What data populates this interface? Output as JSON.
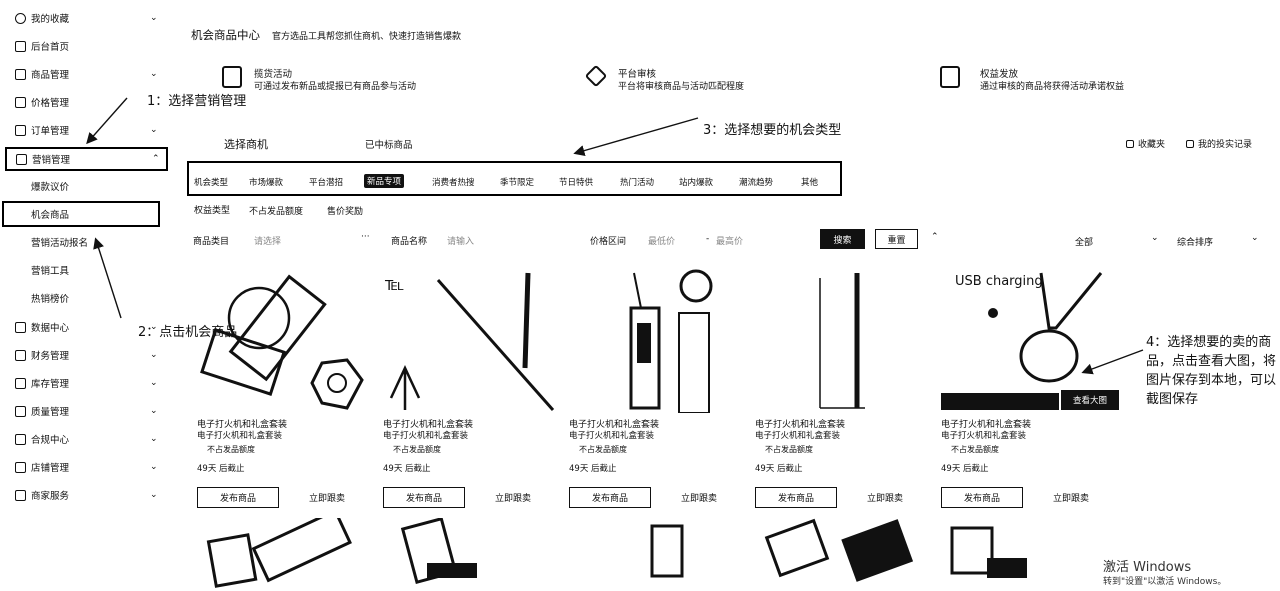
{
  "sidebar": {
    "items": [
      {
        "label": "我的收藏",
        "chev": "⌄"
      },
      {
        "label": "后台首页",
        "chev": ""
      },
      {
        "label": "商品管理",
        "chev": "⌄"
      },
      {
        "label": "价格管理",
        "chev": ""
      },
      {
        "label": "订单管理",
        "chev": "⌄"
      },
      {
        "label": "营销管理",
        "chev": "⌃"
      },
      {
        "label": "数据中心",
        "chev": "⌄"
      },
      {
        "label": "财务管理",
        "chev": "⌄"
      },
      {
        "label": "库存管理",
        "chev": "⌄"
      },
      {
        "label": "质量管理",
        "chev": "⌄"
      },
      {
        "label": "合规中心",
        "chev": "⌄"
      },
      {
        "label": "店铺管理",
        "chev": "⌄"
      },
      {
        "label": "商家服务",
        "chev": "⌄"
      }
    ],
    "sub_items": [
      "爆款议价",
      "机会商品",
      "营销活动报名",
      "营销工具",
      "热销榜价"
    ]
  },
  "header": {
    "title": "机会商品中心",
    "subtitle": "官方选品工具帮您抓住商机、快速打造销售爆款"
  },
  "features": [
    {
      "title": "揽货活动",
      "desc": "可通过发布新品或提报已有商品参与活动"
    },
    {
      "title": "平台审核",
      "desc": "平台将审核商品与活动匹配程度"
    },
    {
      "title": "权益发放",
      "desc": "通过审核的商品将获得活动承诺权益"
    }
  ],
  "tabs": {
    "tab1": "选择商机",
    "tab2": "已中标商品"
  },
  "top_links": {
    "collect": "收藏夹",
    "records": "我的投实记录"
  },
  "type_bar": {
    "label": "机会类型",
    "items": [
      "市场爆款",
      "平台潜招",
      "新品专项",
      "消费者热搜",
      "季节限定",
      "节日特供",
      "热门活动",
      "站内爆款",
      "潮流趋势",
      "其他"
    ],
    "selected_index": 2
  },
  "rights_row": {
    "label": "权益类型",
    "opt1": "不占发品额度",
    "opt2": "售价奖励"
  },
  "filter_row": {
    "category_label": "商品类目",
    "category_placeholder": "请选择",
    "dots": "···",
    "name_label": "商品名称",
    "name_placeholder": "请输入",
    "price_label": "价格区间",
    "price_min": "最低价",
    "price_sep": "-",
    "price_max": "最高价",
    "search_btn": "搜索",
    "reset_btn": "重置",
    "collapse": "⌃",
    "all_select": "全部",
    "sort_select": "综合排序",
    "chev": "⌄"
  },
  "annotations": {
    "a1": "1：选择营销管理",
    "a2": "2：点击机会商品",
    "a3": "3：选择想要的机会类型",
    "a4": "4：选择想要的卖的商品，点击查看大图，将图片保存到本地，可以截图保存"
  },
  "products": [
    {
      "title": "电子打火机和礼盒套装",
      "sub": "电子打火机和礼盒套装",
      "tag": "不占发品额度",
      "days": "49天 后截止",
      "btn1": "发布商品",
      "btn2": "立即跟卖"
    },
    {
      "title": "电子打火机和礼盒套装",
      "sub": "电子打火机和礼盒套装",
      "tag": "不占发品额度",
      "days": "49天 后截止",
      "btn1": "发布商品",
      "btn2": "立即跟卖"
    },
    {
      "title": "电子打火机和礼盒套装",
      "sub": "电子打火机和礼盒套装",
      "tag": "不占发品额度",
      "days": "49天 后截止",
      "btn1": "发布商品",
      "btn2": "立即跟卖"
    },
    {
      "title": "电子打火机和礼盒套装",
      "sub": "电子打火机和礼盒套装",
      "tag": "不占发品额度",
      "days": "49天 后截止",
      "btn1": "发布商品",
      "btn2": "立即跟卖"
    },
    {
      "title": "电子打火机和礼盒套装",
      "sub": "电子打火机和礼盒套装",
      "tag": "不占发品额度",
      "days": "49天 后截止",
      "btn1": "发布商品",
      "btn2": "立即跟卖"
    }
  ],
  "product5_overlay": {
    "usb": "USB charging",
    "view_big": "查看大图"
  },
  "watermark": {
    "line1": "激活 Windows",
    "line2": "转到\"设置\"以激活 Windows。"
  }
}
